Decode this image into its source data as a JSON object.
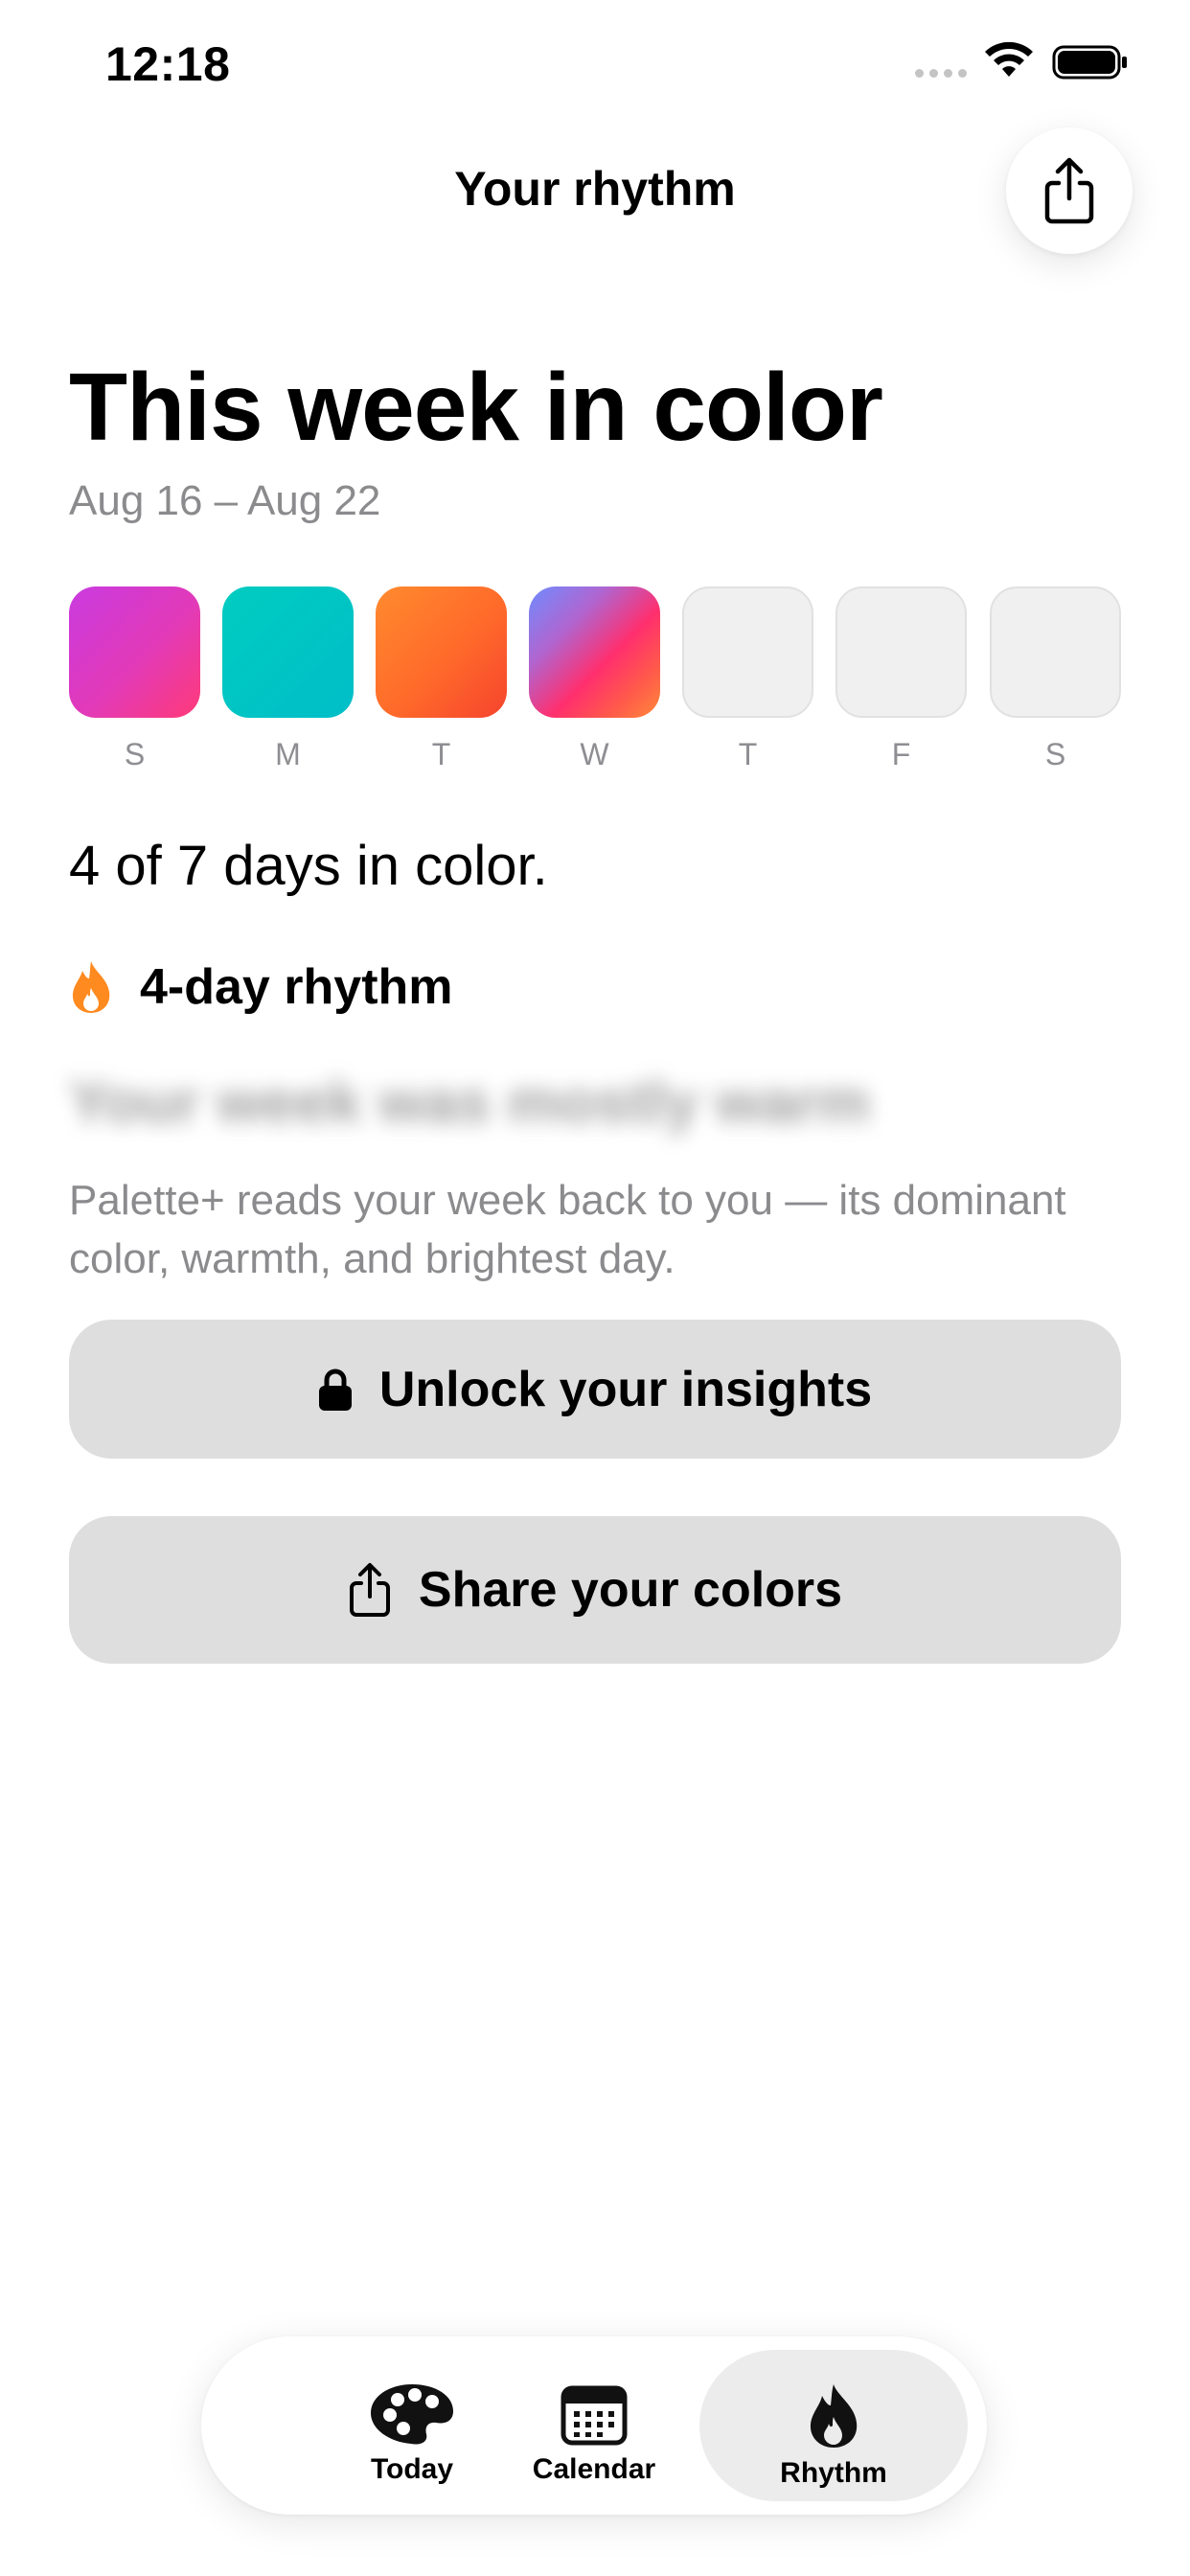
{
  "status_bar": {
    "time": "12:18"
  },
  "header": {
    "title": "Your rhythm",
    "share_icon": "share-icon"
  },
  "headline": "This week in color",
  "date_range": "Aug 16 – Aug 22",
  "week": [
    {
      "letter": "S",
      "filled": true,
      "color": "#d63bd0"
    },
    {
      "letter": "M",
      "filled": true,
      "color": "#00c4c2"
    },
    {
      "letter": "T",
      "filled": true,
      "color": "#ff6a2e"
    },
    {
      "letter": "W",
      "filled": true,
      "color": "#ff2f6e"
    },
    {
      "letter": "T",
      "filled": false
    },
    {
      "letter": "F",
      "filled": false
    },
    {
      "letter": "S",
      "filled": false
    }
  ],
  "summary": "4 of 7 days in color.",
  "rhythm": {
    "label": "4-day rhythm",
    "icon": "flame-icon",
    "color": "#ff8a1f"
  },
  "blurred_insight": "Your week was mostly warm",
  "explanation": "Palette+ reads your week back to you — its dominant color, warmth, and brightest day.",
  "buttons": {
    "unlock": "Unlock your insights",
    "share": "Share your colors"
  },
  "tabs": [
    {
      "label": "Today",
      "icon": "palette-icon",
      "selected": false
    },
    {
      "label": "Calendar",
      "icon": "calendar-icon",
      "selected": false
    },
    {
      "label": "Rhythm",
      "icon": "flame-icon",
      "selected": true
    }
  ]
}
